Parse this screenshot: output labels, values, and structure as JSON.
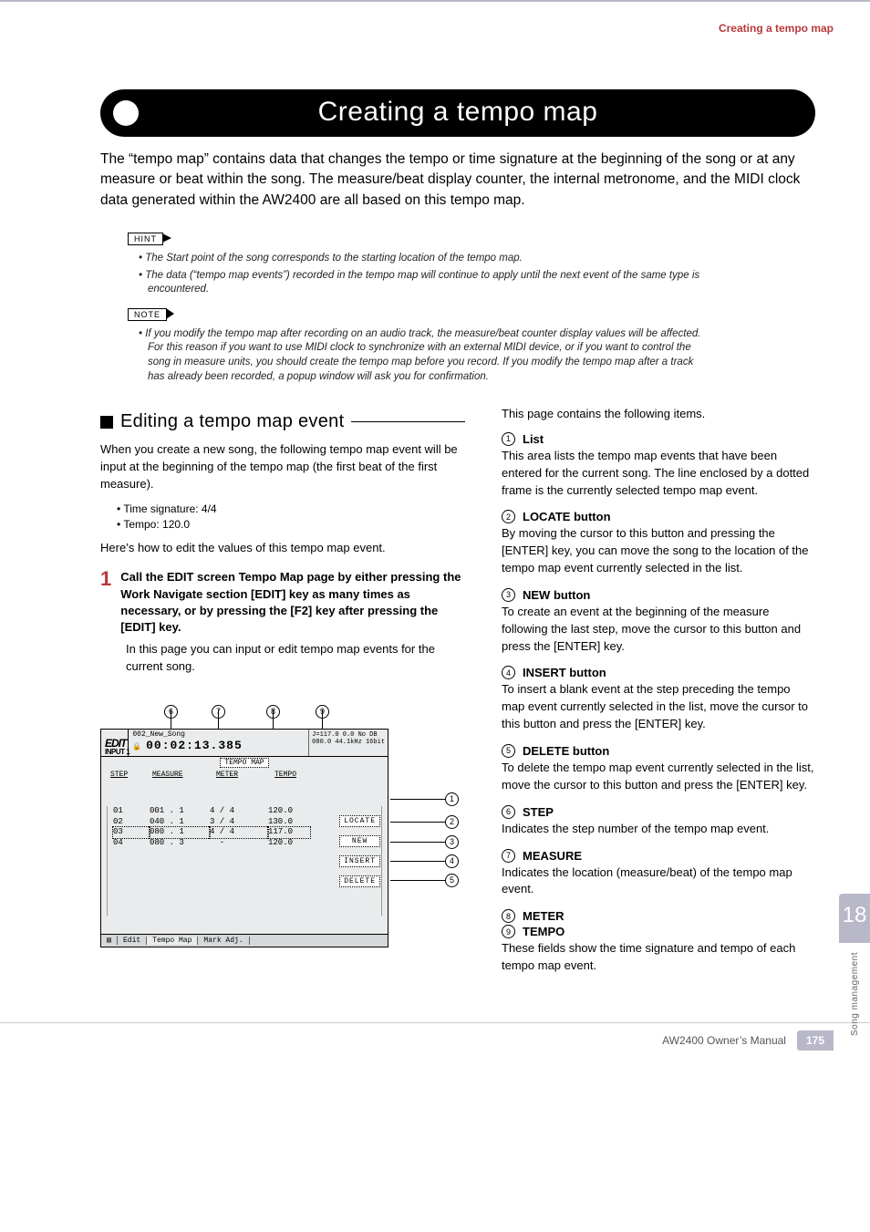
{
  "header": {
    "link": "Creating a tempo map"
  },
  "title": "Creating a tempo map",
  "intro": "The “tempo map” contains data that changes the tempo or time signature at the beginning of the song or at any measure or beat within the song. The measure/beat display counter, the internal metronome, and the MIDI clock data generated within the AW2400 are all based on this tempo map.",
  "hint": {
    "label": "HINT",
    "items": [
      "The Start point of the song corresponds to the starting location of the tempo map.",
      "The data (“tempo map events”) recorded in the tempo map will continue to apply until the next event of the same type is encountered."
    ]
  },
  "note": {
    "label": "NOTE",
    "items": [
      "If you modify the tempo map after recording on an audio track, the measure/beat counter display values will be affected. For this reason if you want to use MIDI clock to synchronize with an external MIDI device, or if you want to control the song in measure units, you should create the tempo map before you record. If you modify the tempo map after a track has already been recorded, a popup window will ask you for confirmation."
    ]
  },
  "left": {
    "subhead": "Editing a tempo map event",
    "p1": "When you create a new song, the following tempo map event will be input at the beginning of the tempo map (the first beat of the first measure).",
    "defaults": [
      "Time signature: 4/4",
      "Tempo: 120.0"
    ],
    "p2": "Here’s how to edit the values of this tempo map event.",
    "step1_num": "1",
    "step1": "Call the EDIT screen Tempo Map page by either pressing the Work Navigate section [EDIT] key as many times as necessary, or by pressing the [F2] key after pressing the [EDIT] key.",
    "step1_note": "In this page you can input or edit tempo map events for the current song."
  },
  "lcd": {
    "edit": "EDIT",
    "input": "INPUT 1",
    "songline": "002_New_Song",
    "time_lock": "🔒",
    "time": "00:02:13.385",
    "j": "J=117.0",
    "rinfo1": "0.0    No DB",
    "rinfo2": "080.0 44.1kHz 16bit",
    "tab": "TEMPO MAP",
    "headers": {
      "step": "STEP",
      "measure": "MEASURE",
      "meter": "METER",
      "tempo": "TEMPO"
    },
    "rows": [
      {
        "step": "01",
        "measure": "001 . 1",
        "meter": "4 / 4",
        "tempo": "120.0",
        "sel": false
      },
      {
        "step": "02",
        "measure": "040 . 1",
        "meter": "3 / 4",
        "tempo": "130.0",
        "sel": false
      },
      {
        "step": "03",
        "measure": "080 . 1",
        "meter": "4 / 4",
        "tempo": "117.0",
        "sel": true
      },
      {
        "step": "04",
        "measure": "080 . 3",
        "meter": "  -  ",
        "tempo": "120.0",
        "sel": false
      }
    ],
    "buttons": [
      "LOCATE",
      "NEW",
      "INSERT",
      "DELETE"
    ],
    "bottom_tabs": [
      "Edit",
      "Tempo Map",
      "Mark Adj."
    ],
    "top_callouts": [
      "6",
      "7",
      "8",
      "9"
    ],
    "right_callouts": [
      "1",
      "2",
      "3",
      "4",
      "5"
    ]
  },
  "right": {
    "lead": "This page contains the following items.",
    "items": [
      {
        "n": "1",
        "title": "List",
        "desc": "This area lists the tempo map events that have been entered for the current song. The line enclosed by a dotted frame is the currently selected tempo map event."
      },
      {
        "n": "2",
        "title": "LOCATE button",
        "desc": "By moving the cursor to this button and pressing the [ENTER] key, you can move the song to the location of the tempo map event currently selected in the list."
      },
      {
        "n": "3",
        "title": "NEW button",
        "desc": "To create an event at the beginning of the measure following the last step, move the cursor to this button and press the [ENTER] key."
      },
      {
        "n": "4",
        "title": "INSERT button",
        "desc": "To insert a blank event at the step preceding the tempo map event currently selected in the list, move the cursor to this button and press the [ENTER] key."
      },
      {
        "n": "5",
        "title": "DELETE button",
        "desc": "To delete the tempo map event currently selected in the list, move the cursor to this button and press the [ENTER] key."
      },
      {
        "n": "6",
        "title": "STEP",
        "desc": "Indicates the step number of the tempo map event."
      },
      {
        "n": "7",
        "title": "MEASURE",
        "desc": "Indicates the location (measure/beat) of the tempo map event."
      }
    ],
    "meter": {
      "n": "8",
      "title": "METER"
    },
    "tempo": {
      "n": "9",
      "title": "TEMPO"
    },
    "meter_tempo_desc": "These fields show the time signature and tempo of each tempo map event."
  },
  "side": {
    "chapter": "18",
    "label": "Song management"
  },
  "footer": {
    "manual": "AW2400  Owner’s Manual",
    "page": "175"
  }
}
